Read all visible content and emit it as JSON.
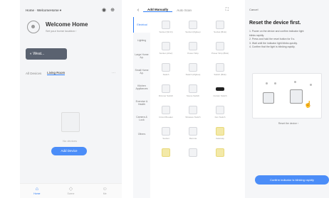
{
  "phone1": {
    "home_selector": "Home · WelcomeHome ▾",
    "top_icons": [
      "speaker-icon",
      "plus-icon"
    ],
    "welcome_title": "Welcome Home",
    "welcome_sub": "Set your home location ›",
    "weather_label": "◐  Weat...",
    "tabs": [
      "All Devices",
      "Living Room"
    ],
    "tab_more": "···",
    "empty_text": "No devices",
    "add_button": "Add Device",
    "bottom_nav": [
      {
        "icon": "home-icon",
        "label": "Home"
      },
      {
        "icon": "scene-icon",
        "label": "Scene"
      },
      {
        "icon": "me-icon",
        "label": "Me"
      }
    ]
  },
  "phone2": {
    "tabs": [
      "Add Manually",
      "Auto Scan"
    ],
    "sidebar": [
      "Electrical",
      "Lighting",
      "Large Home Ap.",
      "Small Home Ap.",
      "Kitchen Appliances",
      "Exercise & Health",
      "Camera & Lock",
      "Others"
    ],
    "devices": [
      {
        "label": "Socket (Wi-Fi)",
        "style": "plain"
      },
      {
        "label": "Socket (Zigbee)",
        "style": "plain"
      },
      {
        "label": "Socket (BLE)",
        "style": "plain"
      },
      {
        "label": "Socket (other)",
        "style": "plain"
      },
      {
        "label": "Power Strip",
        "style": "plain"
      },
      {
        "label": "Power Strip (BLE)",
        "style": "plain"
      },
      {
        "label": "Switch",
        "style": "plain"
      },
      {
        "label": "Switch (Zigbee)",
        "style": "plain"
      },
      {
        "label": "Switch (BLE)",
        "style": "plain"
      },
      {
        "label": "Dimmer Switch",
        "style": "plain"
      },
      {
        "label": "Scene Switch",
        "style": "plain"
      },
      {
        "label": "Curtain Switch",
        "style": "dark"
      },
      {
        "label": "Circuit Breaker",
        "style": "plain"
      },
      {
        "label": "Wireless Switch",
        "style": "plain"
      },
      {
        "label": "Fan Switch",
        "style": "plain"
      },
      {
        "label": "Socket",
        "style": "plain"
      },
      {
        "label": "Remote",
        "style": "plain"
      },
      {
        "label": "Gateway",
        "style": "yellow"
      },
      {
        "label": "",
        "style": "yellow"
      },
      {
        "label": "",
        "style": "plain"
      },
      {
        "label": "",
        "style": "yellow"
      }
    ]
  },
  "phone3": {
    "cancel": "Cancel",
    "title": "Reset the device first.",
    "steps": [
      "1. Power on the device and confirm indicator light",
      "   blinks rapidly.",
      "2. Press and hold the reset button for 5 s.",
      "3. Wait until the indicator light blinks quickly.",
      "4. Confirm that the light is blinking rapidly."
    ],
    "note": "Reset the device ›",
    "next_button": "Confirm indicator is blinking rapidly"
  }
}
